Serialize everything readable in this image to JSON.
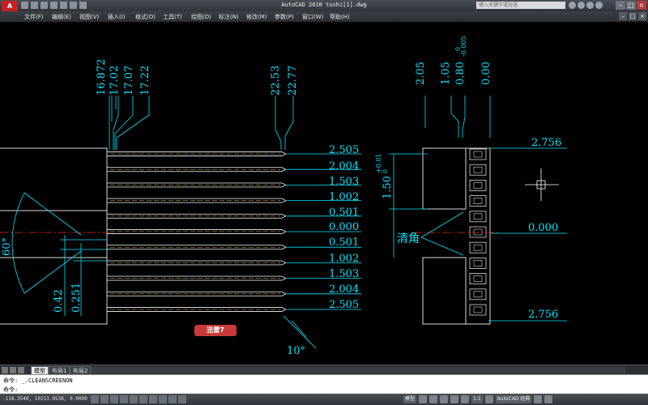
{
  "titlebar": {
    "app_logo": "A",
    "title": "AutoCAD 2010  tuxhi[1].dwg",
    "search_placeholder": "键入关键字或短语",
    "buttons": [
      "–",
      "□",
      "×"
    ]
  },
  "menubar": {
    "items": [
      "文件(F)",
      "编辑(E)",
      "视图(V)",
      "插入(I)",
      "格式(O)",
      "工具(T)",
      "绘图(D)",
      "标注(N)",
      "修改(M)",
      "参数(P)",
      "窗口(W)",
      "帮助(H)"
    ],
    "doc_controls": [
      "–",
      "□",
      "×"
    ]
  },
  "drawing": {
    "top_dims_left": [
      "16.872",
      "17.02",
      "17.07",
      "17.22"
    ],
    "top_dims_mid": [
      "22.53",
      "22.77"
    ],
    "top_dims_right": [
      "2.05",
      "1.05",
      "0.80",
      "0.00"
    ],
    "tol_0_80_upper": "0",
    "tol_0_80_lower": "-0.005",
    "right_dims": [
      "2.505",
      "2.004",
      "1.503",
      "1.002",
      "0.501",
      "0.000",
      "0.501",
      "1.002",
      "1.503",
      "2.004",
      "2.505"
    ],
    "far_right_dims": [
      "2.756",
      "0.000",
      "2.756"
    ],
    "vertical_dim": "1.50",
    "vertical_tol_upper": "+0.01",
    "vertical_tol_lower": "0",
    "annotation_chamfer": "清角",
    "angle_60": "60°",
    "angle_10": "10°",
    "left_dims": [
      "0.42",
      "0.251"
    ],
    "line_color": "#00e5ff",
    "pin_color": "#d8d8d8",
    "centerline_color": "#ff2020"
  },
  "watermark": {
    "label": "迅雷7"
  },
  "tabs": {
    "items": [
      "模型",
      "布局1",
      "布局2"
    ]
  },
  "command": {
    "line1": "命令: _.CLEANSCREENON",
    "line2": "命令:"
  },
  "statusbar": {
    "coords": "-118.3540, 10213.0538, 0.0000",
    "model_label": "模型",
    "scale_label": "1:1",
    "workspace_label": "AutoCAD 经典"
  }
}
